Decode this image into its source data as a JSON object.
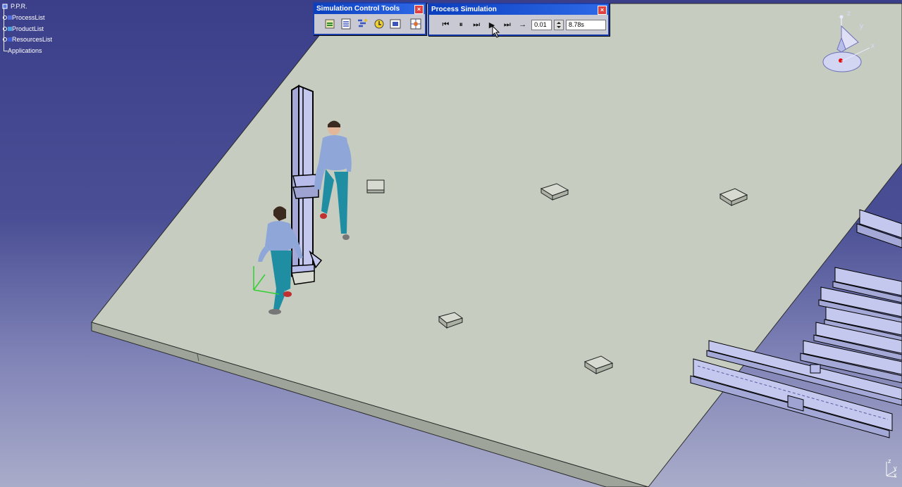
{
  "tree": {
    "root": "P.P.R.",
    "items": [
      {
        "label": "ProcessList",
        "icon": "process-list-icon"
      },
      {
        "label": "ProductList",
        "icon": "product-list-icon"
      },
      {
        "label": "ResourcesList",
        "icon": "resources-list-icon"
      }
    ],
    "applications": "Applications"
  },
  "simulation_control_tools": {
    "title": "Simulation Control Tools",
    "close": "×",
    "tools": [
      {
        "icon": "simulation-step-icon"
      },
      {
        "icon": "simulation-list-icon"
      },
      {
        "icon": "gantt-chart-icon"
      },
      {
        "icon": "clash-detection-icon"
      },
      {
        "icon": "trace-icon"
      },
      {
        "icon": "settings-grid-icon"
      }
    ]
  },
  "process_simulation": {
    "title": "Process Simulation",
    "close": "×",
    "buttons": {
      "rewind": "⏮",
      "pause": "⏸",
      "step_back": "⏭",
      "play": "▶",
      "fast_forward": "⏭",
      "step": "→"
    },
    "step_value": "0.01",
    "time_value": "8.78s"
  },
  "compass": {
    "z": "z",
    "y": "y",
    "x": "x"
  },
  "corner_axis": {
    "z": "z",
    "y": "y",
    "x": "x"
  },
  "colors": {
    "background_top": "#3b3f8a",
    "floor": "#c6ccbf",
    "toolbar_title": "#0a3fbf",
    "beam": "#b9bde8",
    "worker_shirt": "#8fa6d9",
    "worker_pants": "#1f8ea3"
  }
}
